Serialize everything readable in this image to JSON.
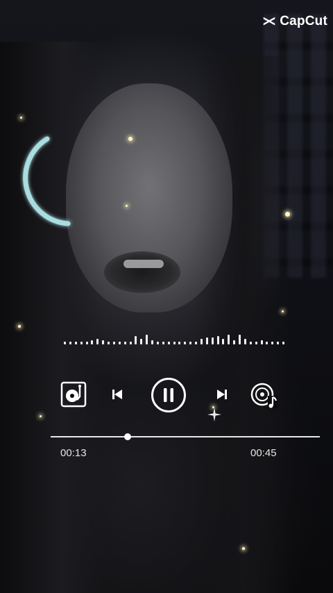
{
  "brand": {
    "name": "CapCut",
    "icon": "capcut-logo-icon"
  },
  "player": {
    "current_time": "00:13",
    "total_time": "00:45",
    "progress": 0.287,
    "state": "playing",
    "buttons": {
      "playlist": "turntable-icon",
      "previous": "skip-previous-icon",
      "pause": "pause-icon",
      "next": "skip-next-icon",
      "music": "music-disc-icon"
    }
  },
  "equalizer": {
    "levels": [
      2,
      2,
      2,
      2,
      2,
      3,
      4,
      3,
      2,
      2,
      2,
      2,
      2,
      6,
      4,
      7,
      3,
      2,
      2,
      2,
      2,
      2,
      2,
      2,
      2,
      4,
      5,
      5,
      6,
      4,
      7,
      3,
      7,
      4,
      2,
      2,
      3,
      2,
      2,
      2,
      2
    ]
  },
  "colors": {
    "ring_accent": "#a9dde0",
    "text": "#ffffff",
    "sparkle": "#fff6c8"
  }
}
